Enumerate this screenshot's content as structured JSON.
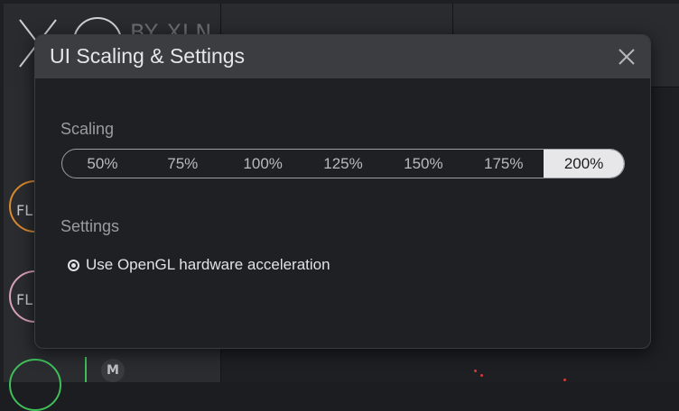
{
  "background": {
    "logo_text": "BY XLN",
    "knobs": [
      {
        "label": "FL",
        "color": "#d9892e"
      },
      {
        "label": "FL",
        "color": "#d9a3b6"
      },
      {
        "label": "",
        "color": "#3fbf5a"
      }
    ],
    "mute_label": "M"
  },
  "dialog": {
    "title": "UI Scaling & Settings",
    "close_icon": "close-icon",
    "scaling": {
      "label": "Scaling",
      "options": [
        "50%",
        "75%",
        "100%",
        "125%",
        "150%",
        "175%",
        "200%"
      ],
      "selected": "200%"
    },
    "settings": {
      "label": "Settings",
      "opengl": {
        "label": "Use OpenGL hardware acceleration",
        "checked": true
      }
    }
  },
  "colors": {
    "accent_selected": "#e7e7e9",
    "dialog_bg": "#1f2023",
    "header_bg": "#3c3d41"
  }
}
